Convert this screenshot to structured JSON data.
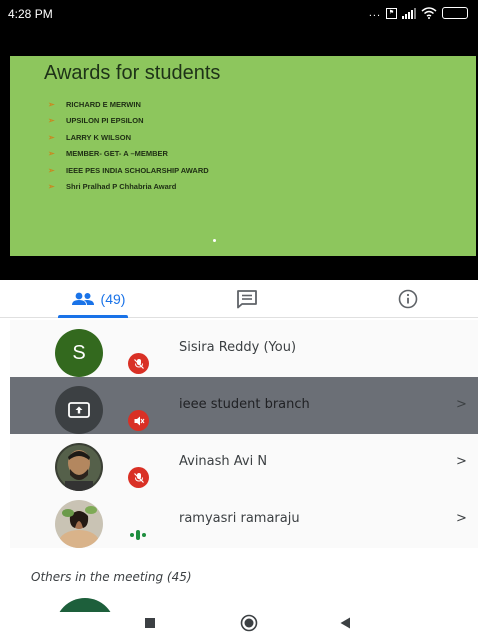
{
  "status_bar": {
    "time": "4:28 PM",
    "more_indicator": "...",
    "icons": [
      "volte-icon",
      "signal-icon",
      "wifi-icon",
      "battery-icon"
    ],
    "battery_level_fraction": 1.0,
    "battery_color": "#f5a623"
  },
  "slide": {
    "title": "Awards for students",
    "background_color": "#8dc65d",
    "bullet_icon": "arrow-bullet-icon",
    "items": [
      "RICHARD E MERWIN",
      "UPSILON PI EPSILON",
      "LARRY K WILSON",
      "MEMBER- GET- A –MEMBER",
      "IEEE PES INDIA SCHOLARSHIP AWARD",
      "Shri Pralhad P Chhabria Award"
    ]
  },
  "tabs": {
    "people_icon": "people-icon",
    "people_count": "(49)",
    "chat_icon": "chat-icon",
    "info_icon": "info-icon",
    "active": "people",
    "accent_color": "#1a73e8"
  },
  "participants": [
    {
      "name": "Sisira Reddy (You)",
      "avatar_letter": "S",
      "avatar_color": "#33691e",
      "status": "muted"
    },
    {
      "name": "ieee student branch",
      "avatar": "present-screen-icon",
      "status": "muted-presenting",
      "chevron": ">"
    },
    {
      "name": "Avinash Avi N",
      "avatar": "photo",
      "status": "muted",
      "chevron": ">"
    },
    {
      "name": "ramyasri ramaraju",
      "avatar": "photo",
      "status": "speaking",
      "chevron": ">"
    }
  ],
  "others_label": "Others in the meeting (45)",
  "nav": {
    "buttons": [
      "recents-square-icon",
      "home-circle-icon",
      "back-triangle-icon"
    ]
  },
  "colors": {
    "mute_badge": "#d93025",
    "speaking": "#1e8e3e",
    "highlight_row": "#6b6f76"
  }
}
